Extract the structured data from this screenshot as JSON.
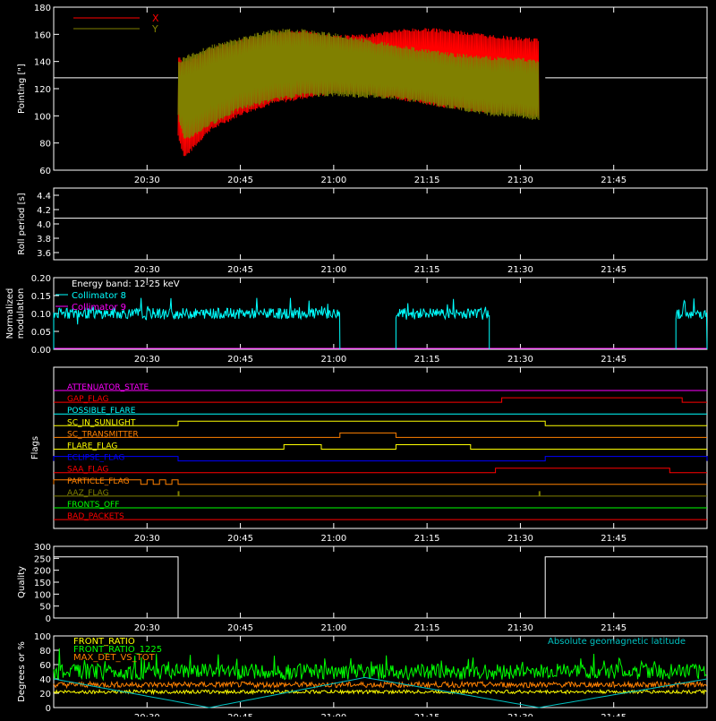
{
  "time_axis": {
    "range": [
      "20:15",
      "22:00"
    ],
    "ticks": [
      "20:30",
      "20:45",
      "21:00",
      "21:15",
      "21:30",
      "21:45"
    ]
  },
  "data_window": {
    "start": "20:35",
    "end": "21:34"
  },
  "colors": {
    "background": "#000000",
    "axes": "#ffffff",
    "x_series": "#ff0000",
    "y_series": "#808000",
    "collimator": "#00ffff",
    "magenta": "#ff00ff",
    "front_ratio": "#ffff00",
    "front_ratio_1225": "#00ff00",
    "max_det": "#ff8000",
    "geolat": "#00c0c0"
  },
  "chart_data": [
    {
      "id": "pointing",
      "type": "area",
      "ylabel": "Pointing [\"]",
      "ylim": [
        60,
        180
      ],
      "yticks": [
        "60",
        "80",
        "100",
        "120",
        "140",
        "160",
        "180"
      ],
      "reference_value": 128,
      "series": [
        {
          "name": "X",
          "color": "#ff0000",
          "x": [
            "20:35",
            "20:36",
            "20:40",
            "20:45",
            "20:50",
            "20:55",
            "21:00",
            "21:05",
            "21:10",
            "21:15",
            "21:20",
            "21:25",
            "21:30",
            "21:33"
          ],
          "upper": [
            145,
            140,
            150,
            156,
            162,
            163,
            160,
            160,
            164,
            165,
            163,
            160,
            158,
            157
          ],
          "lower": [
            84,
            68,
            88,
            100,
            108,
            112,
            116,
            116,
            112,
            108,
            104,
            102,
            101,
            98
          ]
        },
        {
          "name": "Y",
          "color": "#808000",
          "x": [
            "20:35",
            "20:36",
            "20:40",
            "20:45",
            "20:50",
            "20:55",
            "21:00",
            "21:05",
            "21:10",
            "21:15",
            "21:20",
            "21:25",
            "21:30",
            "21:33"
          ],
          "upper": [
            140,
            144,
            152,
            158,
            164,
            164,
            161,
            157,
            153,
            149,
            146,
            144,
            143,
            142
          ],
          "lower": [
            98,
            80,
            92,
            104,
            110,
            114,
            114,
            113,
            112,
            108,
            104,
            100,
            98,
            96
          ]
        }
      ]
    },
    {
      "id": "roll",
      "type": "line",
      "ylabel": "Roll period [s]",
      "ylim": [
        3.5,
        4.5
      ],
      "yticks": [
        "3.6",
        "3.8",
        "4.0",
        "4.2",
        "4.4"
      ],
      "value": 4.08
    },
    {
      "id": "modulation",
      "type": "line",
      "ylabel": "Normalized modulation",
      "ylabel_lines": [
        "Normalized",
        "modulation"
      ],
      "ylim": [
        0,
        0.2
      ],
      "yticks": [
        "0.00",
        "0.05",
        "0.10",
        "0.15",
        "0.20"
      ],
      "annotation": "Energy band: 12-25 keV",
      "series": [
        {
          "name": "Collimator 8",
          "color": "#00ffff",
          "segments": [
            [
              "20:15",
              "21:01"
            ],
            [
              "21:10",
              "21:25"
            ],
            [
              "21:55",
              "22:00"
            ]
          ],
          "level": 0.1
        },
        {
          "name": "Collimator 9",
          "color": "#ff00ff",
          "level": 0.0
        }
      ]
    },
    {
      "id": "flags",
      "type": "line",
      "ylabel": "Flags",
      "flags": [
        {
          "name": "ATTENUATOR_STATE",
          "color": "#ff00ff",
          "segments": []
        },
        {
          "name": "GAP_FLAG",
          "color": "#ff0000",
          "segments": [
            [
              "21:27",
              "21:56"
            ]
          ]
        },
        {
          "name": "POSSIBLE_FLARE",
          "color": "#00ffff",
          "segments": []
        },
        {
          "name": "SC_IN_SUNLIGHT",
          "color": "#ffff00",
          "segments": [
            [
              "20:35",
              "21:34"
            ]
          ]
        },
        {
          "name": "SC_TRANSMITTER",
          "color": "#ff8000",
          "segments": [
            [
              "21:01",
              "21:10"
            ]
          ]
        },
        {
          "name": "FLARE_FLAG",
          "color": "#ffff00",
          "segments": [
            [
              "20:52",
              "20:58"
            ],
            [
              "21:10",
              "21:22"
            ]
          ]
        },
        {
          "name": "ECLIPSE_FLAG",
          "color": "#0000ff",
          "segments": [
            [
              "20:15",
              "20:35"
            ],
            [
              "21:34",
              "22:00"
            ]
          ]
        },
        {
          "name": "SAA_FLAG",
          "color": "#ff0000",
          "segments": [
            [
              "21:26",
              "21:54"
            ]
          ]
        },
        {
          "name": "PARTICLE_FLAG",
          "color": "#ff8000",
          "segments": [
            [
              "20:15",
              "20:29"
            ],
            [
              "20:30",
              "20:31"
            ],
            [
              "20:32",
              "20:33"
            ],
            [
              "20:34",
              "20:35"
            ]
          ]
        },
        {
          "name": "AAZ_FLAG",
          "color": "#808000",
          "segments": [
            [
              "20:35",
              "20:35"
            ],
            [
              "21:33",
              "21:33"
            ]
          ]
        },
        {
          "name": "FRONTS_OFF",
          "color": "#00ff00",
          "segments": []
        },
        {
          "name": "BAD_PACKETS",
          "color": "#ff0000",
          "segments": []
        }
      ]
    },
    {
      "id": "quality",
      "type": "line",
      "ylabel": "Quality",
      "ylim": [
        0,
        300
      ],
      "yticks": [
        "0",
        "50",
        "100",
        "150",
        "200",
        "250",
        "300"
      ],
      "segments": [
        {
          "x": [
            "20:15",
            "20:35"
          ],
          "value": 256
        },
        {
          "x": [
            "20:35",
            "21:34"
          ],
          "value": 0
        },
        {
          "x": [
            "21:34",
            "22:00"
          ],
          "value": 256
        }
      ]
    },
    {
      "id": "ratios",
      "type": "line",
      "ylabel": "Degrees or %",
      "ylim": [
        0,
        100
      ],
      "yticks": [
        "0",
        "20",
        "40",
        "60",
        "80",
        "100"
      ],
      "series": [
        {
          "name": "FRONT_RATIO",
          "color": "#ffff00",
          "level": 22
        },
        {
          "name": "FRONT_RATIO_1225",
          "color": "#00ff00",
          "level": 50
        },
        {
          "name": "MAX_DET_VS_TOT",
          "color": "#ff8000",
          "level": 32
        },
        {
          "name": "Absolute geomagnetic latitude",
          "color": "#00c0c0",
          "x": [
            "20:15",
            "20:40",
            "21:05",
            "21:33",
            "22:00"
          ],
          "values": [
            40,
            0,
            42,
            0,
            40
          ]
        }
      ]
    }
  ]
}
